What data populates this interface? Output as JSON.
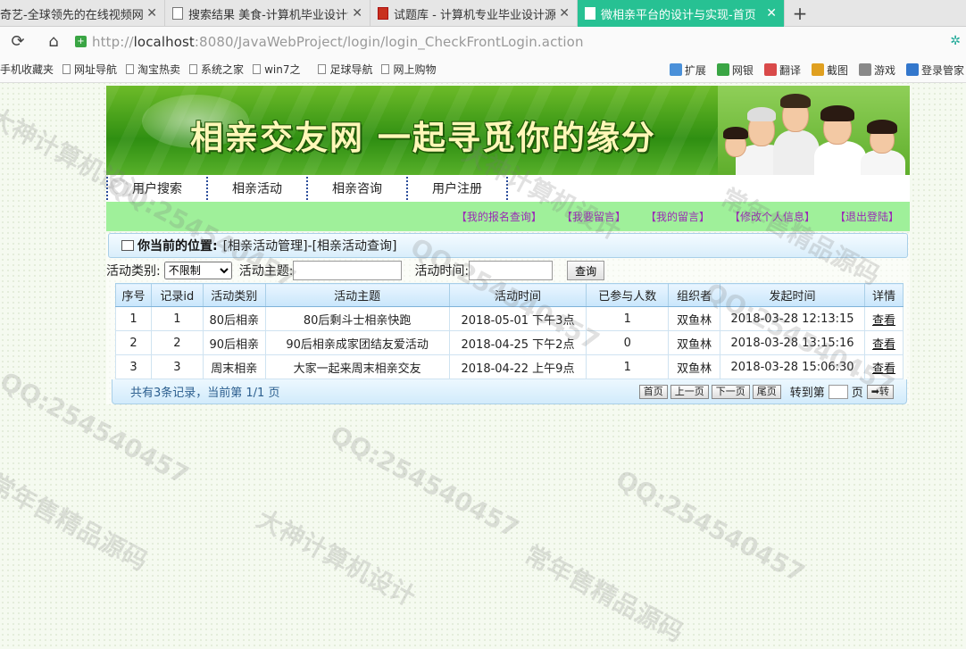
{
  "browser": {
    "tabs": [
      {
        "label": "奇艺-全球领先的在线视频网站",
        "active": false,
        "favicon": "doc-icon"
      },
      {
        "label": "搜索结果 美食-计算机毕业设计源",
        "active": false,
        "favicon": "doc-icon"
      },
      {
        "label": "试题库 - 计算机专业毕业设计源",
        "active": false,
        "favicon": "red-icon"
      },
      {
        "label": "微相亲平台的设计与实现-首页",
        "active": true,
        "favicon": "doc-icon"
      }
    ],
    "url_prefix": "http://",
    "url_host": "localhost",
    "url_rest": ":8080/JavaWebProject/login/login_CheckFrontLogin.action",
    "bookmarks": [
      "手机收藏夹",
      "网址导航",
      "淘宝热卖",
      "系统之家",
      "win7之",
      "足球导航",
      "网上购物"
    ],
    "extensions": [
      {
        "label": "扩展",
        "color": "#4a90d9"
      },
      {
        "label": "网银",
        "color": "#3aa544"
      },
      {
        "label": "翻译",
        "color": "#d94a4a"
      },
      {
        "label": "截图",
        "color": "#e0a020"
      },
      {
        "label": "游戏",
        "color": "#888888"
      },
      {
        "label": "登录管家",
        "color": "#3377cc"
      }
    ]
  },
  "banner": {
    "title": "相亲交友网 一起寻觅你的缘分"
  },
  "nav": [
    "用户搜索",
    "相亲活动",
    "相亲咨询",
    "用户注册"
  ],
  "userbar": [
    "【我的报名查询】",
    "【我要留言】",
    "【我的留言】",
    "【修改个人信息】",
    "【退出登陆】"
  ],
  "location": {
    "label": "你当前的位置:",
    "path": "[相亲活动管理]-[相亲活动查询]"
  },
  "search": {
    "type_label": "活动类别:",
    "type_value": "不限制",
    "topic_label": "活动主题:",
    "time_label": "活动时间:",
    "query_button": "查询"
  },
  "table": {
    "headers": [
      "序号",
      "记录id",
      "活动类别",
      "活动主题",
      "活动时间",
      "已参与人数",
      "组织者",
      "发起时间",
      "详情"
    ],
    "rows": [
      [
        "1",
        "1",
        "80后相亲",
        "80后剩斗士相亲快跑",
        "2018-05-01 下午3点",
        "1",
        "双鱼林",
        "2018-03-28 12:13:15",
        "查看"
      ],
      [
        "2",
        "2",
        "90后相亲",
        "90后相亲成家团结友爱活动",
        "2018-04-25 下午2点",
        "0",
        "双鱼林",
        "2018-03-28 13:15:16",
        "查看"
      ],
      [
        "3",
        "3",
        "周末相亲",
        "大家一起来周末相亲交友",
        "2018-04-22 上午9点",
        "1",
        "双鱼林",
        "2018-03-28 15:06:30",
        "查看"
      ]
    ]
  },
  "pager": {
    "summary": "共有3条记录，当前第 1/1 页",
    "first": "首页",
    "prev": "上一页",
    "next": "下一页",
    "last": "尾页",
    "goto_label": "转到第",
    "goto_suffix": "页",
    "go_button": "➡转"
  },
  "watermarks": [
    "QQ:254540457",
    "大神计算机设计",
    "常年售精品源码"
  ]
}
